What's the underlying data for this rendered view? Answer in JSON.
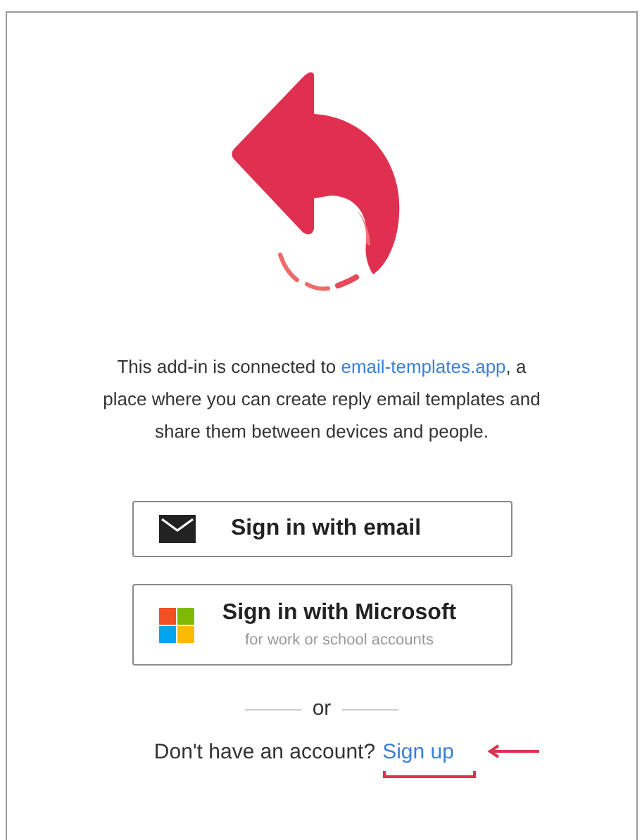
{
  "intro": {
    "before": "This add-in is connected to",
    "link": "email-templates.app",
    "after": ", a place where you can create reply email templates and share them between devices and people."
  },
  "buttons": [
    {
      "kind": "email",
      "label": "Sign in with email"
    },
    {
      "kind": "microsoft",
      "label": "Sign in with Microsoft",
      "sublabel": "for work or school accounts"
    }
  ],
  "separator": "or",
  "signup": {
    "prompt": "Don't have an account?",
    "link": "Sign up"
  }
}
